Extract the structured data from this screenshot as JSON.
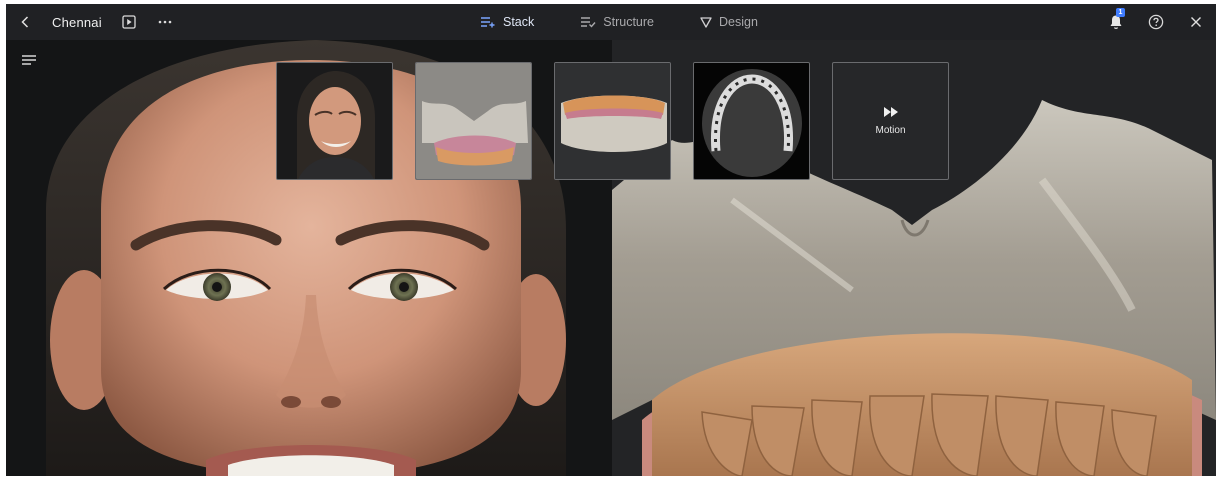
{
  "topbar": {
    "case_title": "Chennai",
    "tabs": [
      {
        "label": "Stack",
        "icon": "stack-icon",
        "active": true
      },
      {
        "label": "Structure",
        "icon": "structure-icon",
        "active": false
      },
      {
        "label": "Design",
        "icon": "design-icon",
        "active": false
      }
    ],
    "notification_count": "1"
  },
  "thumbnails": [
    {
      "kind": "photo",
      "icon": "face-photo-thumbnail"
    },
    {
      "kind": "3d-scan-front",
      "icon": "jaw-scan-front-thumbnail"
    },
    {
      "kind": "3d-scan-side",
      "icon": "jaw-scan-side-thumbnail"
    },
    {
      "kind": "ct-slice",
      "icon": "ct-slice-thumbnail"
    },
    {
      "kind": "motion",
      "label": "Motion",
      "icon": "fast-forward-icon"
    }
  ],
  "colors": {
    "topbar_bg": "#202124",
    "accent": "#3f7cff",
    "canvas_bg": "#1c1d1f"
  }
}
